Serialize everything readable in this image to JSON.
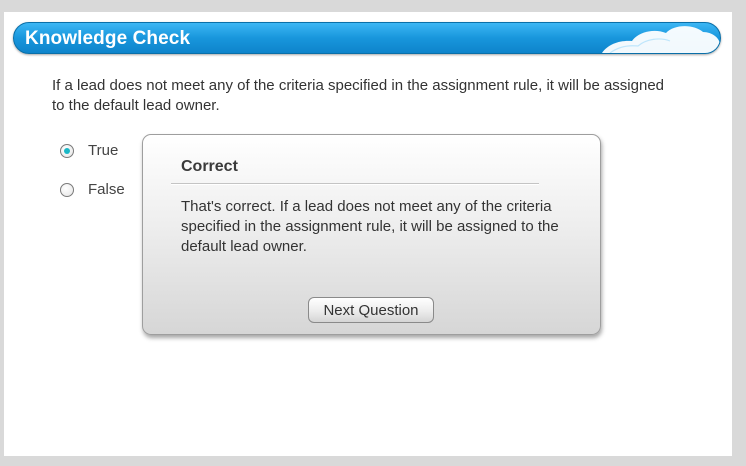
{
  "header": {
    "title": "Knowledge Check"
  },
  "question": {
    "text": "If a lead does not meet any of the criteria specified in the assignment rule, it will be assigned to the default lead owner."
  },
  "options": [
    {
      "label": "True",
      "selected": true
    },
    {
      "label": "False",
      "selected": false
    }
  ],
  "feedback": {
    "title": "Correct",
    "body": "That's correct. If a lead does not meet any of the criteria specified in the assignment rule, it will be assigned to the default lead owner.",
    "next_label": "Next Question"
  },
  "colors": {
    "header_blue": "#1896dc",
    "radio_selected": "#1ab7c6",
    "background_gray": "#d9d9d9"
  }
}
